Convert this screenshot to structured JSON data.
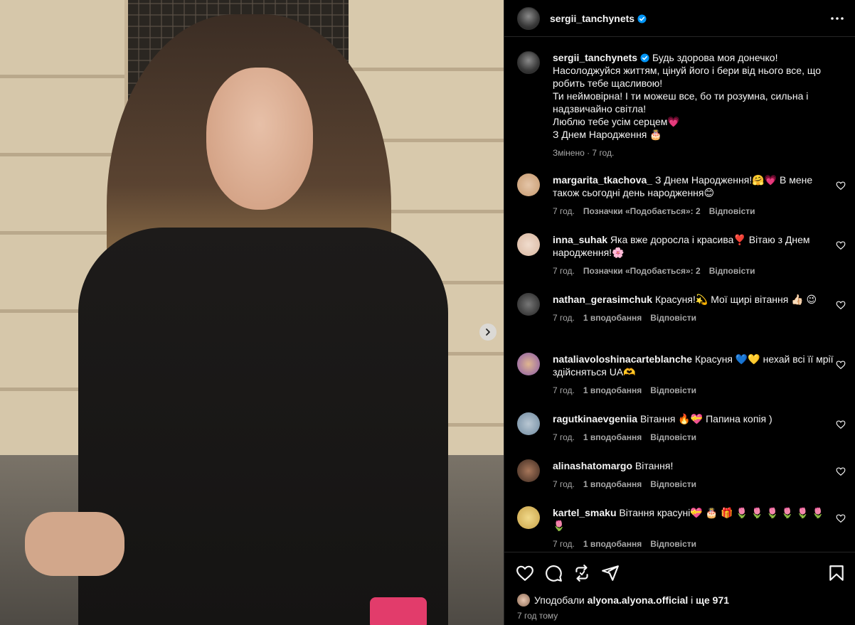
{
  "post": {
    "author": "sergii_tanchynets",
    "caption_lines": [
      "Будь здорова моя донечко!",
      "Насолоджуйся життям, цінуй його і бери від нього все, що робить тебе щасливою!",
      "Ти неймовірна! І ти можеш все, бо ти розумна, сильна і надзвичайно світла!",
      "Люблю тебе усім серцем💗",
      "З Днем Народження 🎂"
    ],
    "edited_meta": "Змінено · 7 год."
  },
  "comments": [
    {
      "user": "margarita_tkachova_",
      "text": "З Днем Народження!🤗💗 В мене також сьогодні день народження😊",
      "time": "7 год.",
      "likes": "Позначки «Подобається»: 2",
      "reply": "Відповісти",
      "avatar_color": "#c79a6f"
    },
    {
      "user": "inna_suhak",
      "text": "Яка вже доросла і красива❣️ Вітаю з Днем народження!🌸",
      "time": "7 год.",
      "likes": "Позначки «Подобається»: 2",
      "reply": "Відповісти",
      "avatar_color": "#d9b7a0"
    },
    {
      "user": "nathan_gerasimchuk",
      "text": "Красуня!💫 Мої щирі вітання 👍🏻 😉",
      "time": "7 год.",
      "likes": "1 вподобання",
      "reply": "Відповісти",
      "avatar_color": "#444444"
    },
    {
      "user": "nataliavoloshinacarteblanche",
      "text": "Красуня 💙💛 нехай всі її мрії здійсняться UA🫶",
      "time": "7 год.",
      "likes": "1 вподобання",
      "reply": "Відповісти",
      "avatar_color": "#8a5aa8"
    },
    {
      "user": "ragutkinaevgeniia",
      "text": "Вітання 🔥💝 Папина копія )",
      "time": "7 год.",
      "likes": "1 вподобання",
      "reply": "Відповісти",
      "avatar_color": "#6f8aa0"
    },
    {
      "user": "alinashatomargo",
      "text": "Вітання!",
      "time": "7 год.",
      "likes": "1 вподобання",
      "reply": "Відповісти",
      "avatar_color": "#5a3a2c"
    },
    {
      "user": "kartel_smaku",
      "text": "Вітання красуні💝 🎂 🎁 🌷 🌷 🌷 🌷 🌷 🌷 🌷",
      "time": "7 год.",
      "likes": "1 вподобання",
      "reply": "Відповісти",
      "avatar_color": "#c8a248"
    }
  ],
  "likes_line": {
    "prefix": "Уподобали",
    "user": "alyona.alyona.official",
    "middle": "і",
    "rest": "ще 971"
  },
  "post_time": "7 год тому",
  "icons": {
    "verified": "verified-badge-icon",
    "more": "more-options-icon",
    "next": "chevron-right-icon",
    "like": "heart-icon",
    "comment": "comment-icon",
    "share": "repost-icon",
    "send": "send-icon",
    "save": "bookmark-icon"
  },
  "colors": {
    "background": "#000000",
    "text": "#f5f5f5",
    "muted": "#a8a8a8",
    "verified": "#0095f6",
    "divider": "#262626"
  }
}
